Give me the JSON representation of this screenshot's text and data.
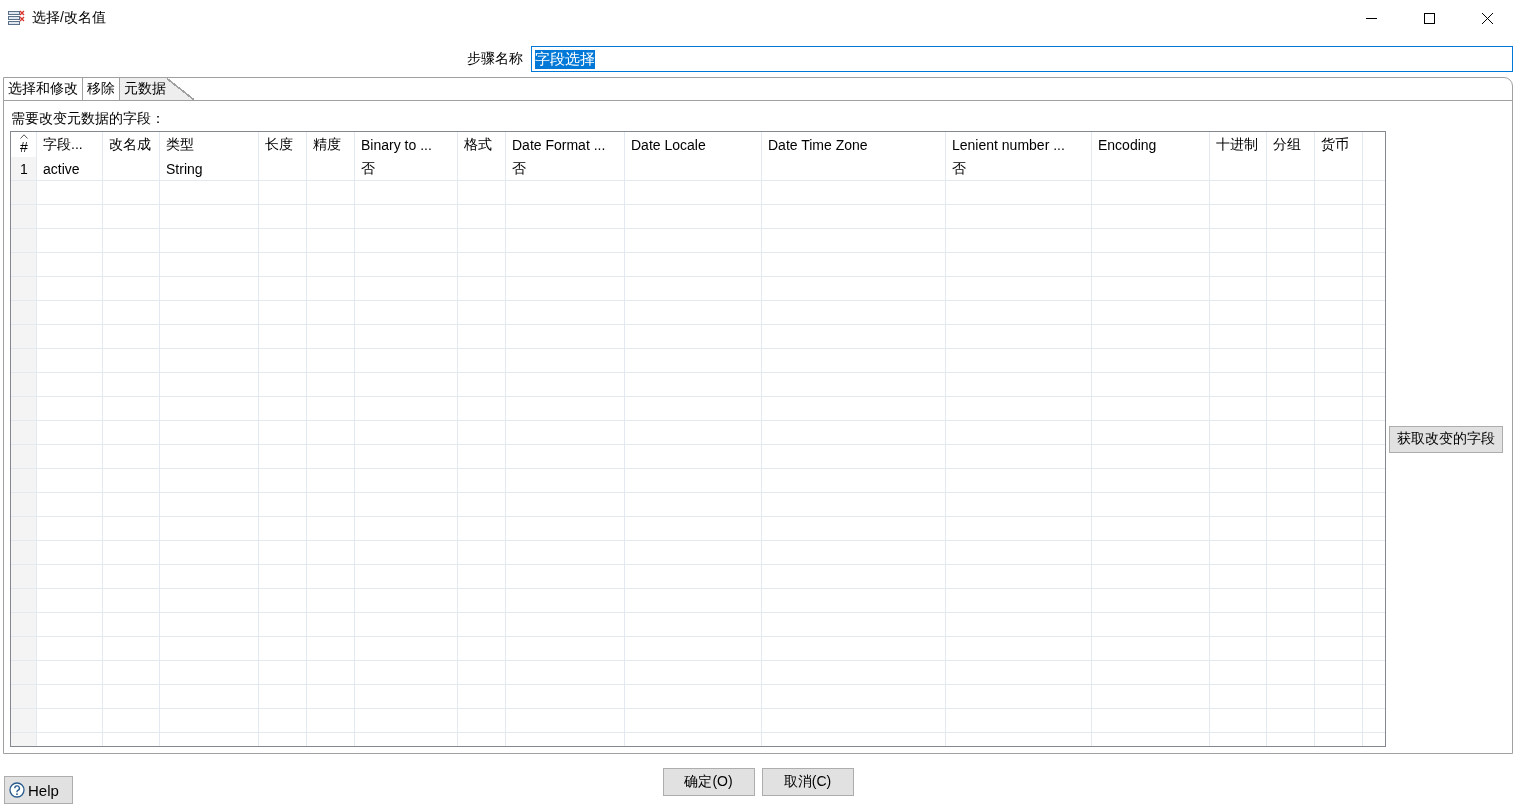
{
  "window": {
    "title": "选择/改名值"
  },
  "step_name": {
    "label": "步骤名称",
    "value": "字段选择",
    "text_selected": true
  },
  "tabs": [
    {
      "label": "选择和修改",
      "selected": false
    },
    {
      "label": "移除",
      "selected": false
    },
    {
      "label": "元数据",
      "selected": true
    }
  ],
  "metadata_panel": {
    "label": "需要改变元数据的字段：",
    "table": {
      "columns": [
        "#",
        "字段...",
        "改名成",
        "类型",
        "长度",
        "精度",
        "Binary to ...",
        "格式",
        "Date Format ...",
        "Date Locale",
        "Date Time Zone",
        "Lenient number ...",
        "Encoding",
        "十进制",
        "分组",
        "货币"
      ],
      "rows": [
        [
          "1",
          "active",
          null,
          "String",
          null,
          null,
          "否",
          null,
          "否",
          null,
          null,
          "否",
          null,
          null,
          null,
          null
        ]
      ]
    },
    "get_fields_button": "获取改变的字段"
  },
  "buttons": {
    "help": "Help",
    "ok": "确定(O)",
    "cancel": "取消(C)"
  }
}
